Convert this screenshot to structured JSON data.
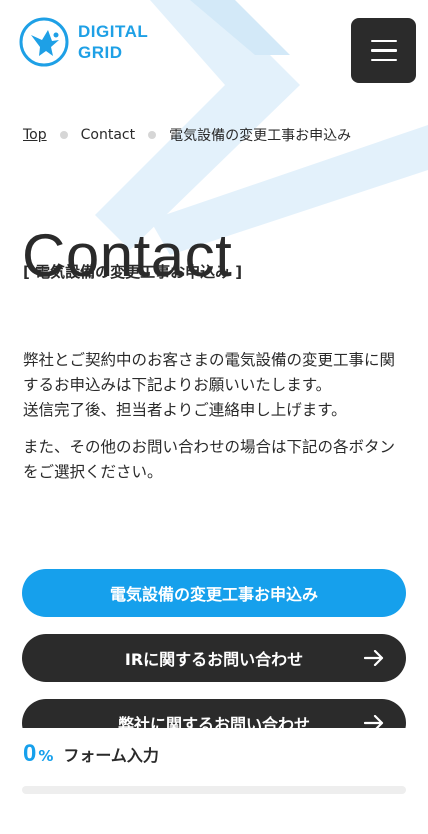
{
  "header": {
    "logo_line1": "DIGITAL",
    "logo_line2": "GRID",
    "menu_icon": "hamburger-icon"
  },
  "breadcrumb": {
    "items": [
      "Top",
      "Contact",
      "電気設備の変更工事お申込み"
    ]
  },
  "page": {
    "title": "Contact",
    "subtitle": "[ 電気設備の変更工事お申込み ]"
  },
  "intro": {
    "paragraph1_line1": "弊社とご契約中のお客さまの電気設備の変更工事に関するお申込みは下記よりお願いいたします。",
    "paragraph1_line2": "送信完了後、担当者よりご連絡申し上げます。",
    "paragraph2": "また、その他のお問い合わせの場合は下記の各ボタンをご選択ください。"
  },
  "buttons": {
    "primary_label": "電気設備の変更工事お申込み",
    "ir_label": "IRに関するお問い合わせ",
    "company_label": "弊社に関するお問い合わせ",
    "arrow_icon": "arrow-right-icon"
  },
  "progress": {
    "value": "0",
    "unit": "%",
    "label": "フォーム入力",
    "fraction": 0
  },
  "colors": {
    "accent": "#16a0ec",
    "dark": "#2b2b2b",
    "deco": "#d6ecfa"
  }
}
